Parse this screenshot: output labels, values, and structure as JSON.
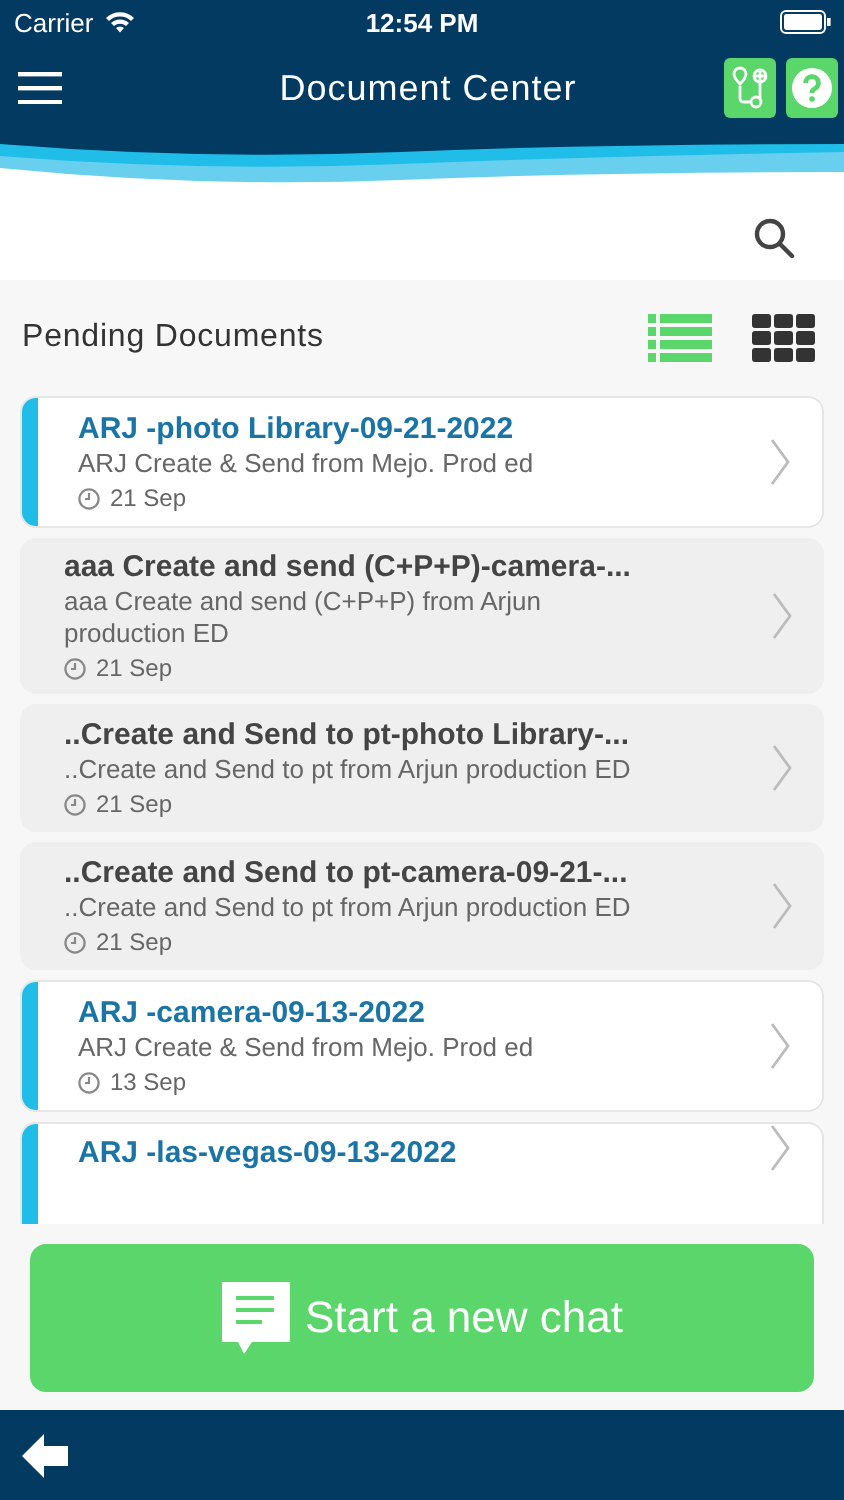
{
  "status_bar": {
    "carrier": "Carrier",
    "time": "12:54 PM"
  },
  "header": {
    "title": "Document Center"
  },
  "section": {
    "title": "Pending Documents",
    "views": [
      {
        "kind": "list",
        "selected": true
      },
      {
        "kind": "grid",
        "selected": false
      }
    ]
  },
  "documents": [
    {
      "title": "ARJ -photo Library-09-21-2022",
      "subtitle": "ARJ Create & Send from Mejo. Prod ed",
      "date": "21 Sep",
      "unread": true
    },
    {
      "title": "aaa Create and send (C+P+P)-camera-...",
      "subtitle": "aaa Create and send (C+P+P) from Arjun production ED",
      "date": "21 Sep",
      "unread": false
    },
    {
      "title": "..Create and Send to pt-photo Library-...",
      "subtitle": "..Create and Send to pt from Arjun production ED",
      "date": "21 Sep",
      "unread": false
    },
    {
      "title": "..Create and Send to pt-camera-09-21-...",
      "subtitle": "..Create and Send to pt from Arjun production ED",
      "date": "21 Sep",
      "unread": false
    },
    {
      "title": "ARJ -camera-09-13-2022",
      "subtitle": "ARJ Create & Send from Mejo. Prod ed",
      "date": "13 Sep",
      "unread": true
    },
    {
      "title": "ARJ -las-vegas-09-13-2022",
      "unread": true
    }
  ],
  "chat_button": {
    "label": "Start a new chat"
  }
}
